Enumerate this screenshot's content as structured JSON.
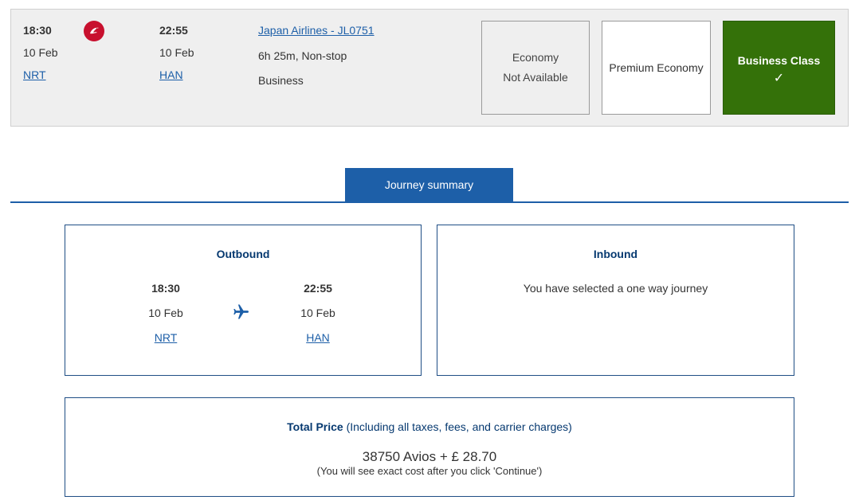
{
  "flight": {
    "departure": {
      "time": "18:30",
      "date": "10 Feb",
      "airport": "NRT"
    },
    "arrival": {
      "time": "22:55",
      "date": "10 Feb",
      "airport": "HAN"
    },
    "airline_link": "Japan Airlines - JL0751",
    "duration": "6h 25m, Non-stop",
    "cabin": "Business",
    "logo_icon": "jal-crane-logo",
    "cabins": {
      "economy_line1": "Economy",
      "economy_line2": "Not Available",
      "premium": "Premium Economy",
      "business": "Business Class",
      "business_check": "✓"
    }
  },
  "summary": {
    "tab_label": "Journey summary",
    "outbound": {
      "title": "Outbound",
      "departure": {
        "time": "18:30",
        "date": "10 Feb",
        "airport": "NRT"
      },
      "arrival": {
        "time": "22:55",
        "date": "10 Feb",
        "airport": "HAN"
      },
      "icon": "plane-icon"
    },
    "inbound": {
      "title": "Inbound",
      "message": "You have selected a one way journey"
    },
    "price": {
      "label_bold": "Total Price",
      "label_rest": " (Including all taxes, fees, and carrier charges)",
      "amount": "38750 Avios + £ 28.70",
      "note": "(You will see exact cost after you click 'Continue')"
    }
  },
  "colors": {
    "link": "#1d5fa8",
    "tab": "#1d5fa8",
    "business_selected": "#347109",
    "heading": "#063970",
    "logo_red": "#c8102e"
  }
}
